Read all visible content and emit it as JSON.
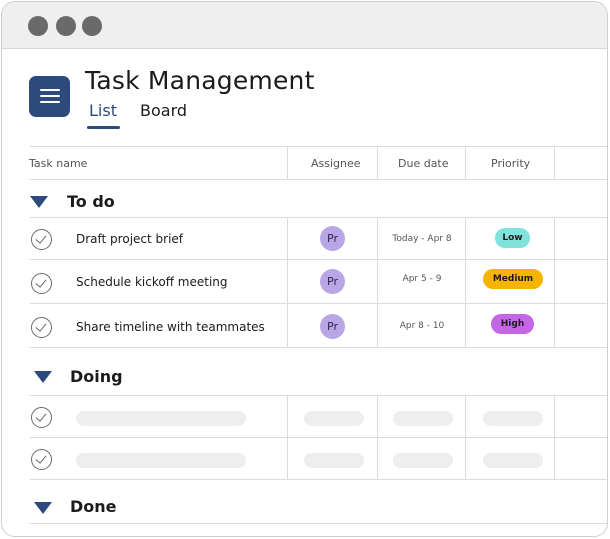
{
  "app": {
    "title": "Task Management"
  },
  "tabs": [
    {
      "label": "List",
      "active": true
    },
    {
      "label": "Board",
      "active": false
    }
  ],
  "columns": [
    "Task name",
    "Assignee",
    "Due date",
    "Priority"
  ],
  "sections": [
    {
      "title": "To do",
      "tasks": [
        {
          "name": "Draft project brief",
          "assignee": "Pr",
          "due": "Today - Apr 8",
          "priority": "Low",
          "priority_color": "#7fe3dc"
        },
        {
          "name": "Schedule kickoff meeting",
          "assignee": "Pr",
          "due": "Apr 5 - 9",
          "priority": "Medium",
          "priority_color": "#f6b400"
        },
        {
          "name": "Share timeline with teammates",
          "assignee": "Pr",
          "due": "Apr 8 - 10",
          "priority": "High",
          "priority_color": "#c466e6"
        }
      ]
    },
    {
      "title": "Doing",
      "placeholder_rows": 2
    },
    {
      "title": "Done"
    }
  ],
  "colors": {
    "accent": "#2c4a7c",
    "avatar": "#b9a6e6"
  },
  "icons": {
    "app": "menu-icon",
    "check": "check-circle-icon",
    "collapse": "triangle-down-icon"
  }
}
